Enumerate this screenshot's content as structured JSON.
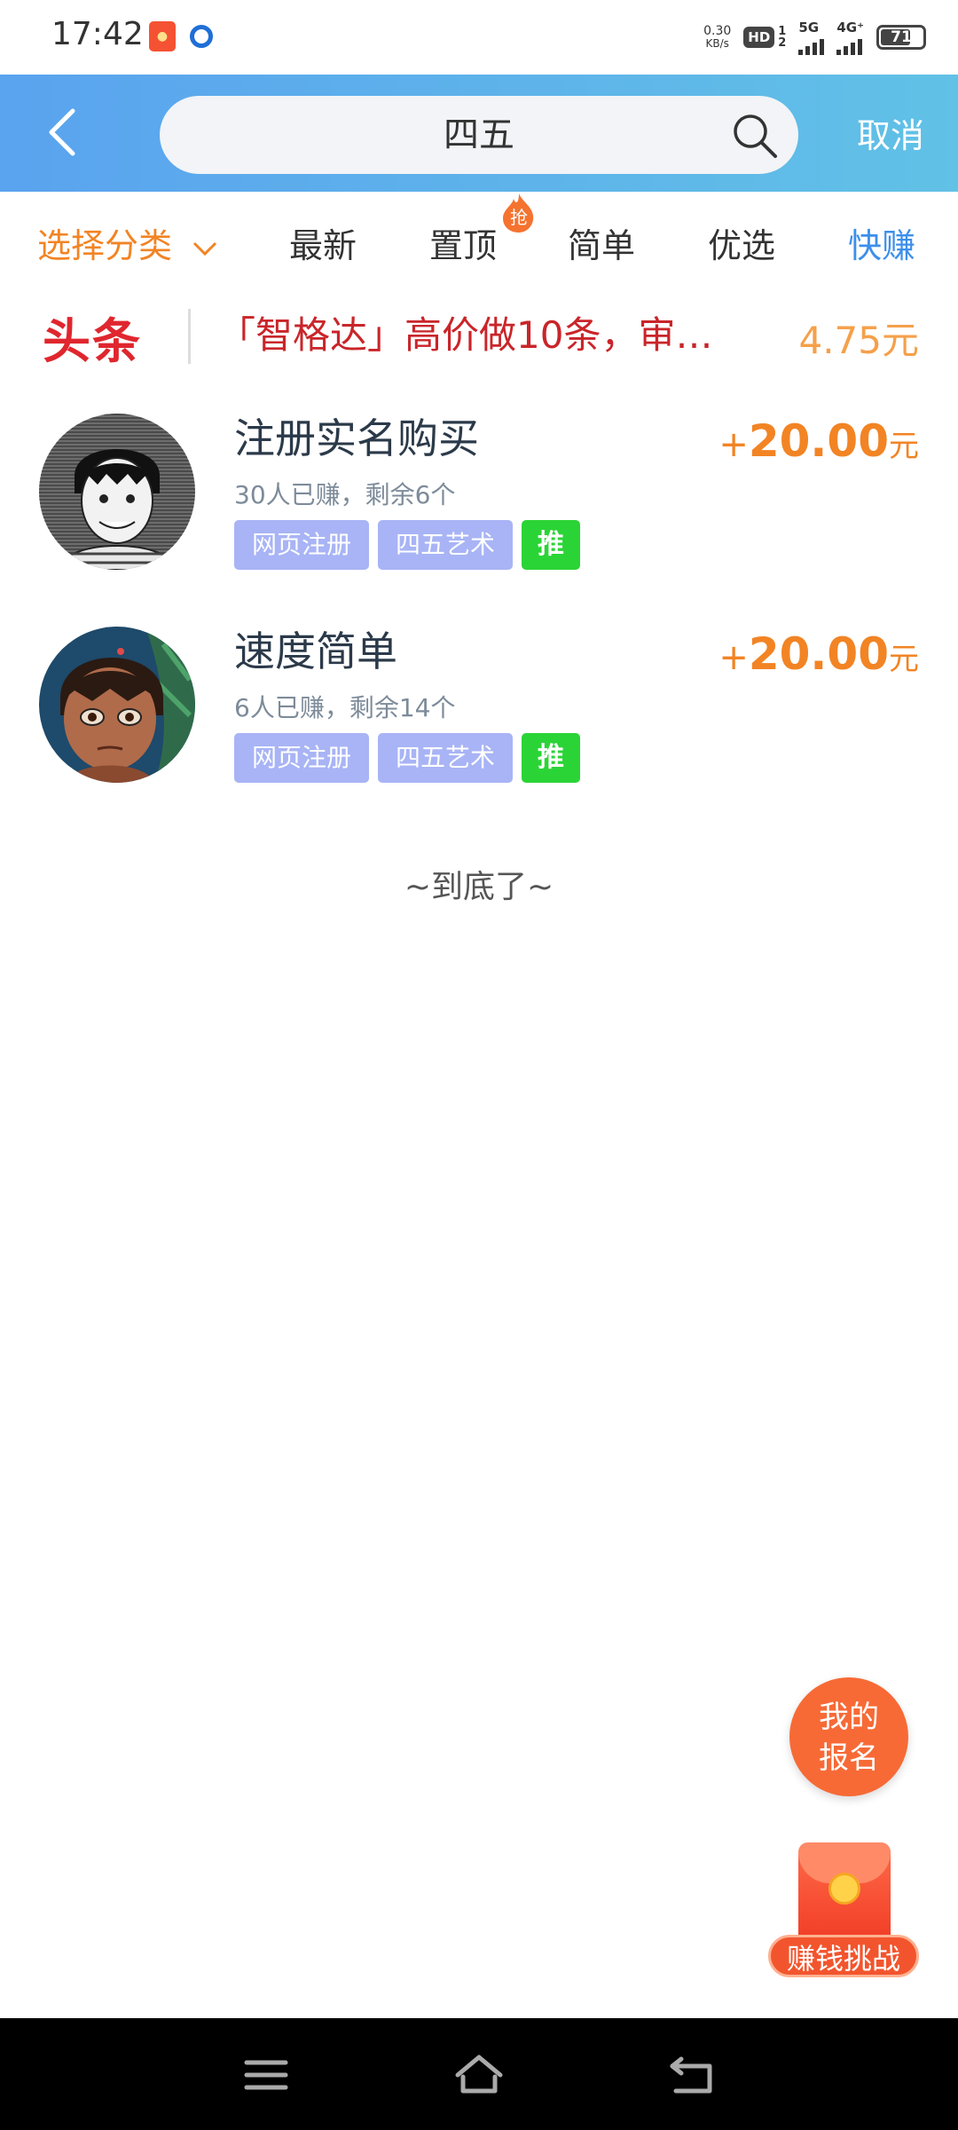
{
  "status_bar": {
    "time": "17:42",
    "net_speed_value": "0.30",
    "net_speed_unit": "KB/s",
    "hd_label": "HD",
    "sim1": "1",
    "sim2": "2",
    "network_5g": "5G",
    "network_4g": "4G⁺",
    "battery": "71",
    "battery_level": 0.71
  },
  "header": {
    "back_icon": "chevron-left-icon",
    "search_query": "四五",
    "search_icon": "search-icon",
    "cancel_label": "取消"
  },
  "tabs": {
    "category_label": "选择分类",
    "items": [
      "最新",
      "置顶",
      "简单",
      "优选",
      "快赚"
    ],
    "hot_badge": "抢",
    "active_index": 4
  },
  "headline": {
    "logo": "头条",
    "text": "「智格达」高价做10条，审…",
    "price": "4.75元"
  },
  "tasks": [
    {
      "title": "注册实名购买",
      "meta": "30人已赚，剩余6个",
      "tags": [
        "网页注册",
        "四五艺术"
      ],
      "push_tag": "推",
      "reward_sign": "+",
      "reward_amount": "20.00",
      "reward_unit": "元"
    },
    {
      "title": "速度简单",
      "meta": "6人已赚，剩余14个",
      "tags": [
        "网页注册",
        "四五艺术"
      ],
      "push_tag": "推",
      "reward_sign": "+",
      "reward_amount": "20.00",
      "reward_unit": "元"
    }
  ],
  "end_text": "~到底了~",
  "floating": {
    "signup_line1": "我的",
    "signup_line2": "报名",
    "challenge_label": "赚钱挑战"
  },
  "nav_bar": {
    "menu_icon": "menu-icon",
    "home_icon": "home-icon",
    "back_icon": "back-icon"
  },
  "colors": {
    "header_gradient_start": "#5aa3ef",
    "header_gradient_end": "#61c1e6",
    "accent_orange": "#f28424",
    "accent_blue": "#3d8fea",
    "headline_red": "#c9252a",
    "tag_purple": "#a8b4f5",
    "tag_green": "#2bd436"
  }
}
